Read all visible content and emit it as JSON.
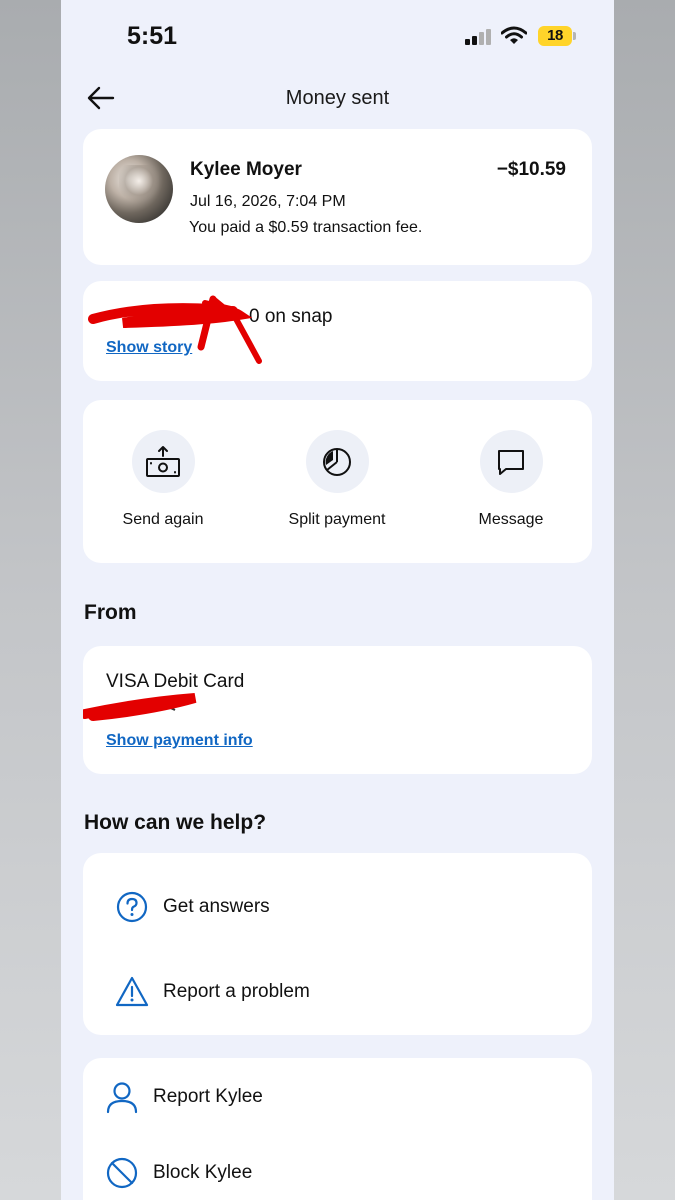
{
  "status_bar": {
    "time": "5:51",
    "battery": "18"
  },
  "header": {
    "title": "Money sent"
  },
  "transaction": {
    "name": "Kylee Moyer",
    "amount": "−$10.59",
    "date": "Jul 16, 2026, 7:04 PM",
    "fee_note": "You paid a $0.59 transaction fee."
  },
  "note": {
    "text": "0 on snap",
    "link": "Show story"
  },
  "actions": [
    {
      "label": "Send again",
      "icon": "send-money-icon"
    },
    {
      "label": "Split payment",
      "icon": "pie-chart-icon"
    },
    {
      "label": "Message",
      "icon": "message-icon"
    }
  ],
  "from": {
    "section_title": "From",
    "card_name": "VISA Debit Card",
    "link": "Show payment info"
  },
  "help": {
    "section_title": "How can we help?",
    "items": [
      {
        "label": "Get answers",
        "icon": "question-circle-icon"
      },
      {
        "label": "Report a problem",
        "icon": "warning-triangle-icon"
      }
    ]
  },
  "user_actions": [
    {
      "label": "Report Kylee",
      "icon": "person-icon"
    },
    {
      "label": "Block Kylee",
      "icon": "block-icon"
    }
  ],
  "colors": {
    "link": "#1167c3",
    "background": "#eef1fb",
    "card": "#ffffff",
    "redaction": "#e30000"
  }
}
